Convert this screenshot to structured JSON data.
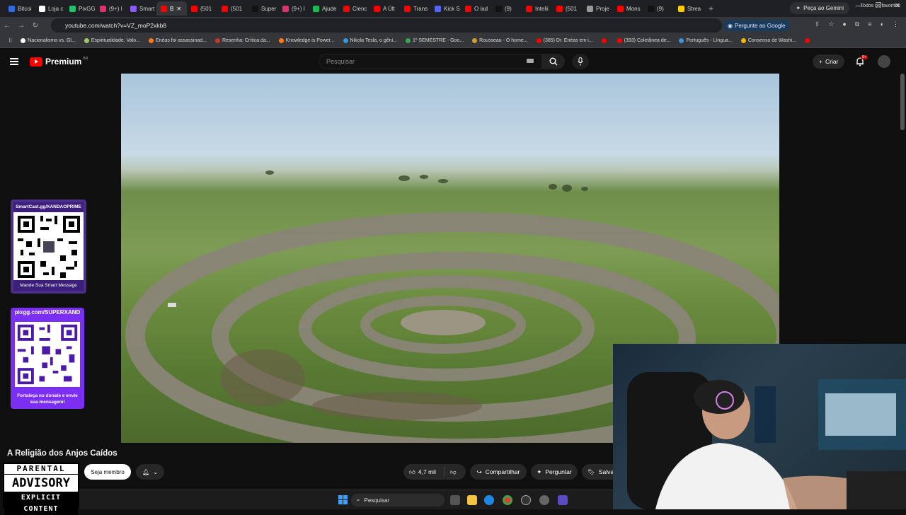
{
  "browser": {
    "tabs": [
      {
        "label": "Bitcoi",
        "color": "#2f6be0"
      },
      {
        "label": "Loja c",
        "color": "#ffffff"
      },
      {
        "label": "PixGG",
        "color": "#25c26e"
      },
      {
        "label": "(9+) I",
        "color": "#e1306c"
      },
      {
        "label": "Smart",
        "color": "#8a5cf6"
      },
      {
        "label": "B",
        "color": "#ff0000",
        "active": true
      },
      {
        "label": "(501",
        "color": "#ff0000"
      },
      {
        "label": "(501",
        "color": "#ff0000"
      },
      {
        "label": "Super",
        "color": "#111111"
      },
      {
        "label": "(9+) I",
        "color": "#e1306c"
      },
      {
        "label": "Ajude",
        "color": "#1db954"
      },
      {
        "label": "Cienc",
        "color": "#ff0000"
      },
      {
        "label": "A Últ",
        "color": "#ff0000"
      },
      {
        "label": "Trans",
        "color": "#ff0000"
      },
      {
        "label": "Kick S",
        "color": "#5865f2"
      },
      {
        "label": "O lad",
        "color": "#ff0000"
      },
      {
        "label": "(9)",
        "color": "#111111"
      },
      {
        "label": "Intelii",
        "color": "#ff0000"
      },
      {
        "label": "(501",
        "color": "#ff0000"
      },
      {
        "label": "Proje",
        "color": "#999999"
      },
      {
        "label": "Mons",
        "color": "#ff0000"
      },
      {
        "label": "(9)",
        "color": "#111111"
      },
      {
        "label": "Strea",
        "color": "#ffcc00"
      }
    ],
    "new_tab": "+",
    "gemini_label": "Peça ao Gemini",
    "url": "youtube.com/watch?v=VZ_moP2xkb8",
    "ask_google": "Pergunte ao Google",
    "bookmarks": [
      {
        "label": "Nacionalismo vs. Gl...",
        "color": "#ffffff"
      },
      {
        "label": "Espiritualidade, Valo...",
        "color": "#a0c86a"
      },
      {
        "label": "Enéas foi assassinad...",
        "color": "#ff7a1a"
      },
      {
        "label": "Resenha: Crítica da...",
        "color": "#c0392b"
      },
      {
        "label": "Knowledge is Power...",
        "color": "#ff7a1a"
      },
      {
        "label": "Nikola Tesla, o gêni...",
        "color": "#3498db"
      },
      {
        "label": "1º SEMESTRE - Goo...",
        "color": "#34a853"
      },
      {
        "label": "Rousseau - O home...",
        "color": "#c9a227"
      },
      {
        "label": "(385) Dr. Enéas em i...",
        "color": "#ff0000"
      },
      {
        "label": "",
        "color": "#ff0000"
      },
      {
        "label": "(393) Coletânea de...",
        "color": "#ff0000"
      },
      {
        "label": "Português - Língua...",
        "color": "#3498db"
      },
      {
        "label": "Consenso de Washi...",
        "color": "#f4b400"
      },
      {
        "label": "",
        "color": "#ff0000"
      }
    ],
    "all_favorites": "Todos os favoritos"
  },
  "youtube": {
    "logo": "Premium",
    "region": "BR",
    "search_placeholder": "Pesquisar",
    "create_label": "Criar",
    "notification_count": "9+",
    "video_title": "A Religião dos Anjos Caídos",
    "member_label": "Seja membro",
    "likes": "4,7 mil",
    "share_label": "Compartilhar",
    "ask_label": "Perguntar",
    "save_label": "Salva"
  },
  "overlays": {
    "qr1_top": "SmartCast.gg/XANDAOPRIME",
    "qr1_bottom": "Mande Sua Smart Message",
    "qr2_top": "pixgg.com/SUPERXAND",
    "qr2_bottom": "Fortaleça no donate e envie sua mensagem!",
    "advisory_top": "PARENTAL",
    "advisory_mid": "ADVISORY",
    "advisory_bot": "EXPLICIT CONTENT"
  },
  "taskbar": {
    "search": "Pesquisar"
  }
}
